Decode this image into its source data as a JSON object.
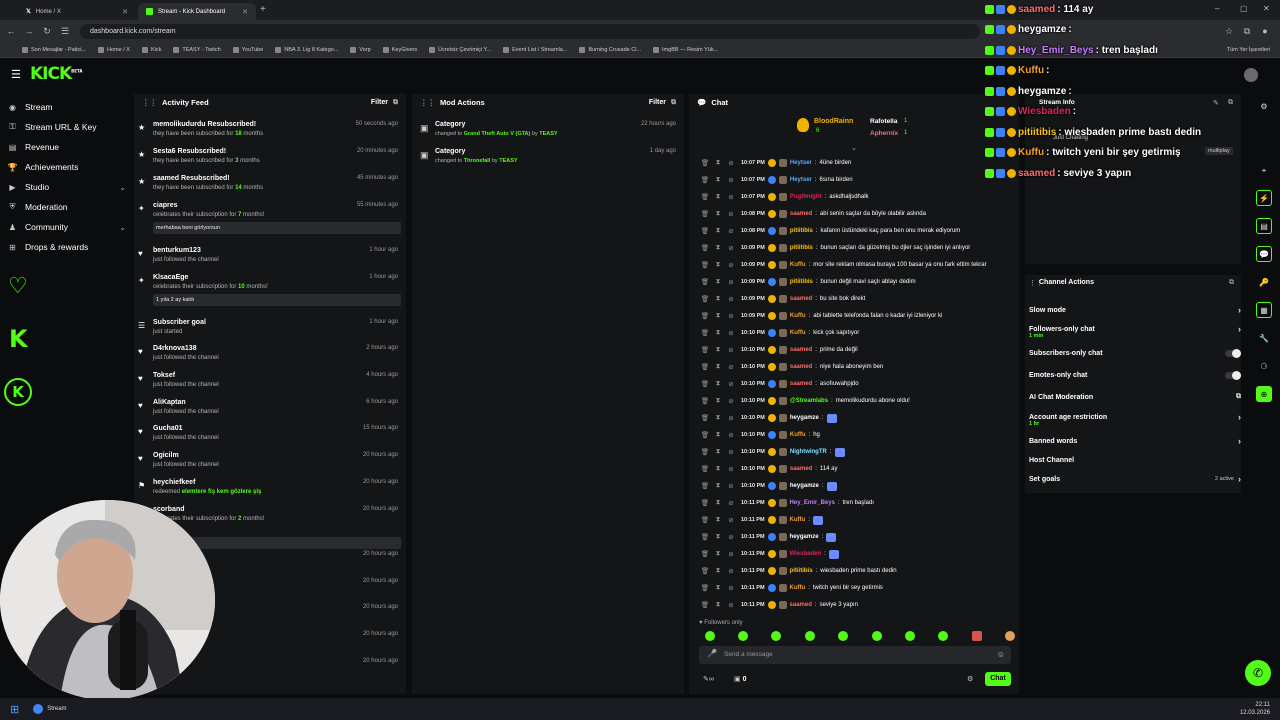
{
  "browser": {
    "tabs": [
      {
        "label": "Home / X",
        "icon": "x-logo-icon"
      },
      {
        "label": "Stream - Kick Dashboard",
        "icon": "kick-logo-icon"
      }
    ],
    "url": "dashboard.kick.com/stream",
    "bookmarks": [
      "Son Mesajlar - Patici...",
      "Home / X",
      "Kick",
      "TEASY - Twitch",
      "YouTube",
      "NBA 3. Lig 8 Katego...",
      "Vorp",
      "KeyGivers",
      "Ücretsiz Çevrimiçi Y...",
      "Event List / Streamla...",
      "Burning Crusade Cl...",
      "ImgBB — Resim Yük..."
    ],
    "bookmarks_right": "Tüm Yer İşaretleri"
  },
  "app": {
    "logo": "KICK",
    "logo_tag": "BETA"
  },
  "sidebar": {
    "items": [
      {
        "label": "Stream",
        "icon": "stream-icon"
      },
      {
        "label": "Stream URL & Key",
        "icon": "key-icon"
      },
      {
        "label": "Revenue",
        "icon": "revenue-icon"
      },
      {
        "label": "Achievements",
        "icon": "trophy-icon"
      },
      {
        "label": "Studio",
        "icon": "studio-icon"
      },
      {
        "label": "Moderation",
        "icon": "shield-icon"
      },
      {
        "label": "Community",
        "icon": "community-icon"
      },
      {
        "label": "Drops & rewards",
        "icon": "gift-icon"
      }
    ]
  },
  "activity_feed": {
    "title": "Activity Feed",
    "filter": "Filter",
    "items": [
      {
        "name": "memolikudurdu Resubscribed!",
        "desc": "they have been subscribed for ",
        "hl": "18",
        "desc2": " months",
        "time": "50 seconds ago"
      },
      {
        "name": "Sesta6 Resubscribed!",
        "desc": "they have been subscribed for ",
        "hl": "3",
        "desc2": " months",
        "time": "20 minutes ago"
      },
      {
        "name": "saamed Resubscribed!",
        "desc": "they have been subscribed for ",
        "hl": "14",
        "desc2": " months",
        "time": "45 minutes ago"
      },
      {
        "name": "ciapres",
        "desc": "celebrates their subscription for ",
        "hl": "7",
        "desc2": " months!",
        "time": "55 minutes ago",
        "msg": "merhabaa beni görlyorsun"
      },
      {
        "name": "benturkum123",
        "desc": "just followed the channel",
        "time": "1 hour ago"
      },
      {
        "name": "KlsacaEge",
        "desc": "celebrates their subscription for ",
        "hl": "10",
        "desc2": " months!",
        "time": "1 hour ago",
        "msg": "1 yıla 2 ay kaldı"
      },
      {
        "name": "Subscriber goal",
        "desc": "just started",
        "time": "1 hour ago"
      },
      {
        "name": "D4rknova138",
        "desc": "just followed the channel",
        "time": "2 hours ago"
      },
      {
        "name": "Toksef",
        "desc": "just followed the channel",
        "time": "4 hours ago"
      },
      {
        "name": "AliKaptan",
        "desc": "just followed the channel",
        "time": "6 hours ago"
      },
      {
        "name": "Gucha01",
        "desc": "just followed the channel",
        "time": "15 hours ago"
      },
      {
        "name": "Ogicilm",
        "desc": "just followed the channel",
        "time": "20 hours ago"
      },
      {
        "name": "heychiefkeef",
        "desc": "redeemed ",
        "hl": "elemtere fiş kem gözlere şiş",
        "desc2": "",
        "time": "20 hours ago"
      },
      {
        "name": "scorband",
        "desc": "celebrates their subscription for ",
        "hl": "2",
        "desc2": " months!",
        "time": "20 hours ago"
      },
      {
        "name": "",
        "desc": "channel",
        "time": "20 hours ago"
      },
      {
        "name": "",
        "desc": "",
        "time": "20 hours ago"
      },
      {
        "name": "",
        "desc": "",
        "time": "20 hours ago"
      },
      {
        "name": "",
        "desc": "",
        "time": "20 hours ago"
      },
      {
        "name": "",
        "desc": "",
        "time": "20 hours ago"
      }
    ]
  },
  "mod_actions": {
    "title": "Mod Actions",
    "filter": "Filter",
    "items": [
      {
        "name": "Category",
        "pre": "changed to ",
        "hl": "Grand Theft Auto V (GTA)",
        "by": " by ",
        "user": "TEASY",
        "time": "22 hours ago"
      },
      {
        "name": "Category",
        "pre": "changed to ",
        "hl": "Thronefall",
        "by": " by ",
        "user": "TEASY",
        "time": "1 day ago"
      }
    ]
  },
  "chat": {
    "title": "Chat",
    "leaderboard": [
      {
        "name": "BloodRainn",
        "count": "6"
      },
      {
        "name": "Rafotella",
        "count": "1"
      },
      {
        "name": "Aphernix",
        "count": "1"
      }
    ],
    "messages": [
      {
        "time": "10:07 PM",
        "user": "Heytser",
        "color": "#5aa9ff",
        "text": "4üne birden"
      },
      {
        "time": "10:07 PM",
        "user": "Heytser",
        "color": "#5aa9ff",
        "text": "6sına birden"
      },
      {
        "time": "10:07 PM",
        "user": "Pugthnight",
        "color": "#e0245e",
        "text": "askdhaljsdhalk"
      },
      {
        "time": "10:08 PM",
        "user": "saamed",
        "color": "#ff6b6b",
        "text": "abi senin saçlar da böyle olabilir aslında"
      },
      {
        "time": "10:08 PM",
        "user": "pitiitibis",
        "color": "#f5c518",
        "text": "kafanın üstündeki kaç para ben onu merak ediyorum"
      },
      {
        "time": "10:09 PM",
        "user": "pitiitibis",
        "color": "#f5c518",
        "text": "bunun saçları da güzelmiş bu djler saç işinden iyi anlıyor"
      },
      {
        "time": "10:09 PM",
        "user": "Kuffu",
        "color": "#f0a030",
        "text": "mor site reklam olmasa buraya 100 basar ya onu fark ettim tekrar"
      },
      {
        "time": "10:09 PM",
        "user": "pitiitibis",
        "color": "#f5c518",
        "text": "bunun değil mavi saçlı ablayı dedim"
      },
      {
        "time": "10:09 PM",
        "user": "saamed",
        "color": "#ff6b6b",
        "text": "bu site bok direkt"
      },
      {
        "time": "10:09 PM",
        "user": "Kuffu",
        "color": "#f0a030",
        "text": "abi tablette telefonda falan o kadar iyi izleniyor ki"
      },
      {
        "time": "10:10 PM",
        "user": "Kuffu",
        "color": "#f0a030",
        "text": "kick çok sapıtıyor"
      },
      {
        "time": "10:10 PM",
        "user": "saamed",
        "color": "#ff6b6b",
        "text": "prime da değil"
      },
      {
        "time": "10:10 PM",
        "user": "saamed",
        "color": "#ff6b6b",
        "text": "niye hala aboneyim ben"
      },
      {
        "time": "10:10 PM",
        "user": "saamed",
        "color": "#ff6b6b",
        "text": "asofıuwahpjdo"
      },
      {
        "time": "10:10 PM",
        "user": "@Streamlabs",
        "color": "#53fc18",
        "text": "memolikudurdu abone oldu!"
      },
      {
        "time": "10:10 PM",
        "user": "heygamze",
        "color": "#ffffff",
        "text": ""
      },
      {
        "time": "10:10 PM",
        "user": "Kuffu",
        "color": "#f0a030",
        "text": "hg"
      },
      {
        "time": "10:10 PM",
        "user": "NightwingTR",
        "color": "#7ce0ff",
        "text": ""
      },
      {
        "time": "10:10 PM",
        "user": "saamed",
        "color": "#ff6b6b",
        "text": "114 ay"
      },
      {
        "time": "10:10 PM",
        "user": "heygamze",
        "color": "#ffffff",
        "text": ""
      },
      {
        "time": "10:11 PM",
        "user": "Hey_Emir_Beys",
        "color": "#c77dff",
        "text": "tren başladı"
      },
      {
        "time": "10:11 PM",
        "user": "Kuffu",
        "color": "#f0a030",
        "text": ""
      },
      {
        "time": "10:11 PM",
        "user": "heygamze",
        "color": "#ffffff",
        "text": ""
      },
      {
        "time": "10:11 PM",
        "user": "Wiesbaden",
        "color": "#e0245e",
        "text": ""
      },
      {
        "time": "10:11 PM",
        "user": "pitiitibis",
        "color": "#f5c518",
        "text": "wiesbaden prime bastı dedin"
      },
      {
        "time": "10:11 PM",
        "user": "Kuffu",
        "color": "#f0a030",
        "text": "twitch yeni bir sey getirmis"
      },
      {
        "time": "10:11 PM",
        "user": "saamed",
        "color": "#ff6b6b",
        "text": "seviye 3 yapın"
      }
    ],
    "mode_label": "Followers only",
    "input_placeholder": "Send a message",
    "send_label": "Chat",
    "viewer_count": "0"
  },
  "stream_info": {
    "title": "Stream Info",
    "category": "Just Chatting",
    "tag": "multiplay"
  },
  "channel_actions": {
    "title": "Channel Actions",
    "items": [
      {
        "label": "Slow mode",
        "kind": "arrow"
      },
      {
        "label": "Followers-only chat",
        "kind": "arrow",
        "sub": "1 min"
      },
      {
        "label": "Subscribers-only chat",
        "kind": "toggle"
      },
      {
        "label": "Emotes-only chat",
        "kind": "toggle"
      },
      {
        "label": "AI Chat Moderation",
        "kind": "external"
      },
      {
        "label": "Account age restriction",
        "kind": "arrow",
        "sub": "1 hr"
      },
      {
        "label": "Banned words",
        "kind": "arrow"
      },
      {
        "label": "Host Channel",
        "kind": "none"
      },
      {
        "label": "Set goals",
        "kind": "arrow",
        "extra": "2 active"
      }
    ]
  },
  "overlay_chat": [
    {
      "user": "saamed",
      "color": "#ff6b6b",
      "text": ": 114 ay"
    },
    {
      "user": "heygamze",
      "color": "#ffffff",
      "text": ":"
    },
    {
      "user": "Hey_Emir_Beys",
      "color": "#c77dff",
      "text": ": tren başladı"
    },
    {
      "user": "Kuffu",
      "color": "#f0a030",
      "text": ":"
    },
    {
      "user": "heygamze",
      "color": "#ffffff",
      "text": ":"
    },
    {
      "user": "Wiesbaden",
      "color": "#e0245e",
      "text": ":"
    },
    {
      "user": "pitiitibis",
      "color": "#f5c518",
      "text": ": wiesbaden prime bastı dedin"
    },
    {
      "user": "Kuffu",
      "color": "#f0a030",
      "text": ": twitch yeni bir şey getirmiş"
    },
    {
      "user": "saamed",
      "color": "#ff6b6b",
      "text": ": seviye 3 yapın"
    }
  ],
  "taskbar": {
    "app_label": "Stream",
    "time": "22:11",
    "date": "12.03.2026"
  },
  "colors": {
    "accent": "#53fc18",
    "panel": "#141517",
    "background": "#0b0c0e"
  }
}
